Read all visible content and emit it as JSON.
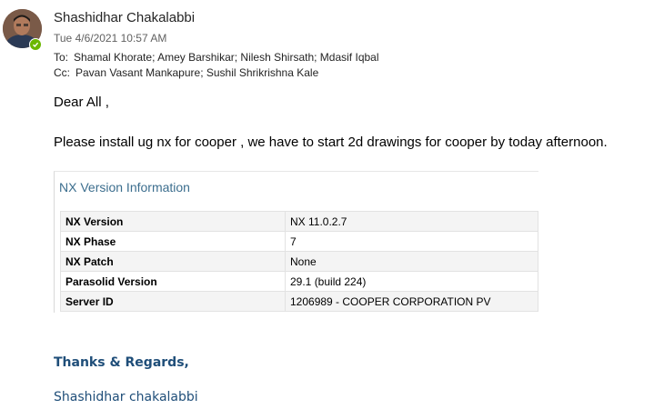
{
  "email": {
    "sender": "Shashidhar Chakalabbi",
    "date": "Tue 4/6/2021 10:57 AM",
    "to_label": "To:",
    "to": "Shamal Khorate; Amey Barshikar; Nilesh Shirsath; Mdasif Iqbal",
    "cc_label": "Cc:",
    "cc": "Pavan Vasant Mankapure; Sushil Shrikrishna Kale",
    "greeting": "Dear All ,",
    "message": "Please install ug nx for cooper , we have to start 2d drawings for cooper by today afternoon.",
    "presence_status": "available",
    "presence_color": "#6bb700"
  },
  "nx_info": {
    "title": "NX Version Information",
    "rows": [
      {
        "key": "NX Version",
        "value": "NX 11.0.2.7"
      },
      {
        "key": "NX Phase",
        "value": "7"
      },
      {
        "key": "NX Patch",
        "value": "None"
      },
      {
        "key": "Parasolid Version",
        "value": "29.1 (build 224)"
      },
      {
        "key": "Server ID",
        "value": "1206989 - COOPER CORPORATION PV"
      }
    ]
  },
  "signature": {
    "closing": "Thanks & Regards,",
    "name": "Shashidhar chakalabbi"
  }
}
